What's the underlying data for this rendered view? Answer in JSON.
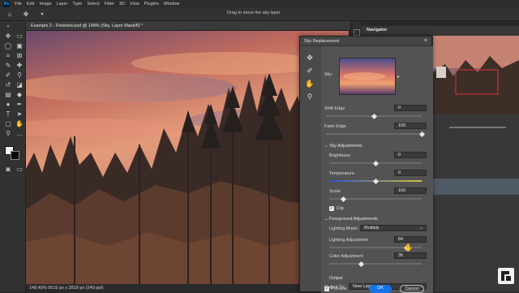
{
  "app": {
    "logo": "Ps"
  },
  "menu": [
    "File",
    "Edit",
    "Image",
    "Layer",
    "Type",
    "Select",
    "Filter",
    "3D",
    "View",
    "Plugins",
    "Window"
  ],
  "options_bar": {
    "hint": "Drag to move the sky layer."
  },
  "document": {
    "tab_title": "Example 2 - Finished.psd @ 148% (Sky, Layer Mask/8) *"
  },
  "status": {
    "text": "148.49%   5615 px x 2818 px (240 ppi)"
  },
  "navigator": {
    "title": "Navigator"
  },
  "dialog": {
    "title": "Sky Replacement",
    "sky_label": "Sky:",
    "shift_edge": {
      "label": "Shift Edge",
      "value": "0",
      "level": 0.5
    },
    "fade_edge": {
      "label": "Fade Edge",
      "value": "100",
      "level": 1.0
    },
    "sky_adjustments": {
      "heading": "Sky Adjustments",
      "brightness": {
        "label": "Brightness",
        "value": "0",
        "level": 0.5
      },
      "temperature": {
        "label": "Temperature",
        "value": "0",
        "level": 0.5
      },
      "scale": {
        "label": "Scale",
        "value": "100",
        "level": 0.15
      },
      "flip": {
        "label": "Flip",
        "checked": true
      }
    },
    "foreground_adjustments": {
      "heading": "Foreground Adjustments",
      "lighting_mode": {
        "label": "Lighting Mode:",
        "value": "Multiply"
      },
      "lighting_adjustment": {
        "label": "Lighting Adjustment",
        "value": "84",
        "level": 0.84
      },
      "color_adjustment": {
        "label": "Color Adjustment",
        "value": "35",
        "level": 0.35
      }
    },
    "output": {
      "heading": "Output",
      "output_to_label": "Output To:",
      "output_to_value": "New Layers"
    },
    "preview": {
      "label": "Preview",
      "checked": true
    },
    "ok_label": "OK",
    "cancel_label": "Cancel"
  },
  "colors": {
    "accent": "#1473e6",
    "panel": "#535353",
    "app_bg": "#282828"
  },
  "icons": {
    "move": "move-icon",
    "brush": "sky-brush-icon",
    "hand": "hand-icon",
    "zoom": "zoom-icon",
    "close": "close-icon"
  }
}
